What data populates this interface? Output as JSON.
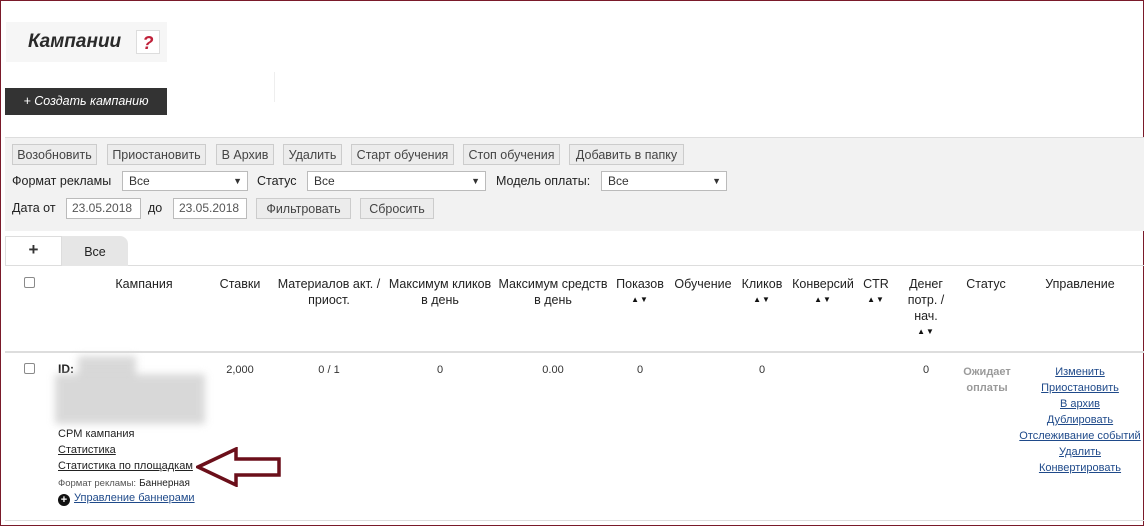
{
  "page": {
    "title": "Кампании",
    "help": "?",
    "create_button": "+ Создать кампанию"
  },
  "toolbar": {
    "buttons": [
      "Возобновить",
      "Приостановить",
      "В Архив",
      "Удалить",
      "Старт обучения",
      "Стоп обучения",
      "Добавить в папку"
    ]
  },
  "filters": {
    "format_label": "Формат рекламы",
    "format_value": "Все",
    "status_label": "Статус",
    "status_value": "Все",
    "payment_label": "Модель оплаты:",
    "payment_value": "Все",
    "date_from_label": "Дата от",
    "date_from": "23.05.2018",
    "date_to_label": "до",
    "date_to": "23.05.2018",
    "filter_button": "Фильтровать",
    "reset_button": "Сбросить"
  },
  "tabs": {
    "add": "+",
    "all": "Все"
  },
  "table": {
    "headers": {
      "campaign": "Кампания",
      "bids": "Ставки",
      "materials_1": "Материалов акт. /",
      "materials_2": "приост.",
      "max_clicks_1": "Максимум кликов",
      "max_clicks_2": "в день",
      "max_funds_1": "Максимум средств",
      "max_funds_2": "в день",
      "impressions": "Показов",
      "training": "Обучение",
      "clicks": "Кликов",
      "conversions": "Конверсий",
      "ctr": "CTR",
      "money_1": "Денег",
      "money_2": "потр. /",
      "money_3": "нач.",
      "status": "Статус",
      "management": "Управление"
    },
    "sort_glyph": "▲▼",
    "row": {
      "id_label": "ID:",
      "campaign_type": "CPM кампания",
      "stats_link": "Статистика",
      "stats_sites_link": "Статистика по площадкам",
      "ad_format_label": "Формат рекламы:",
      "ad_format_value": "Баннерная",
      "banners_link": "Управление баннерами",
      "bids": "2,000",
      "materials": "0 / 1",
      "max_clicks": "0",
      "max_funds": "0.00",
      "impressions": "0",
      "clicks": "0",
      "money": "0",
      "status_1": "Ожидает",
      "status_2": "оплаты",
      "actions": [
        "Изменить",
        "Приостановить",
        "В архив",
        "Дублировать",
        "Отслеживание событий",
        "Удалить",
        "Конвертировать"
      ]
    }
  },
  "colors": {
    "frame": "#7a1a2a",
    "dark_button": "#333333",
    "link": "#1f4a8a",
    "arrow": "#6b0f1a"
  }
}
